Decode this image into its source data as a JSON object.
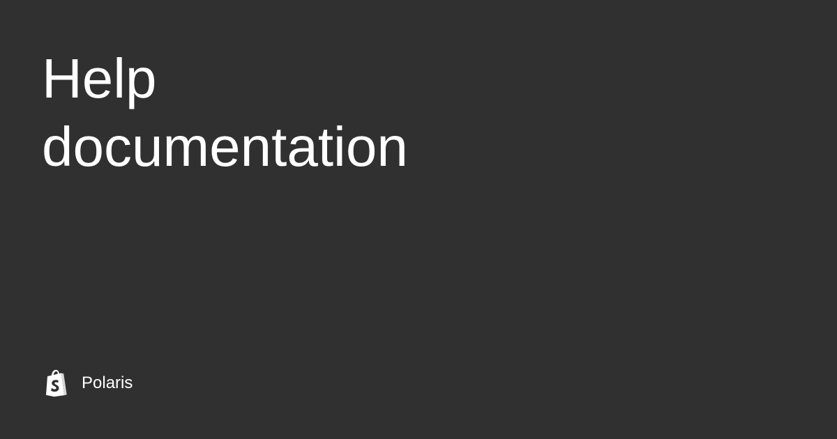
{
  "heading": {
    "line1": "Help",
    "line2": "documentation"
  },
  "brand": {
    "logo_icon": "shopping-bag-icon",
    "name": "Polaris"
  },
  "colors": {
    "background": "#303030",
    "text": "#ffffff"
  }
}
